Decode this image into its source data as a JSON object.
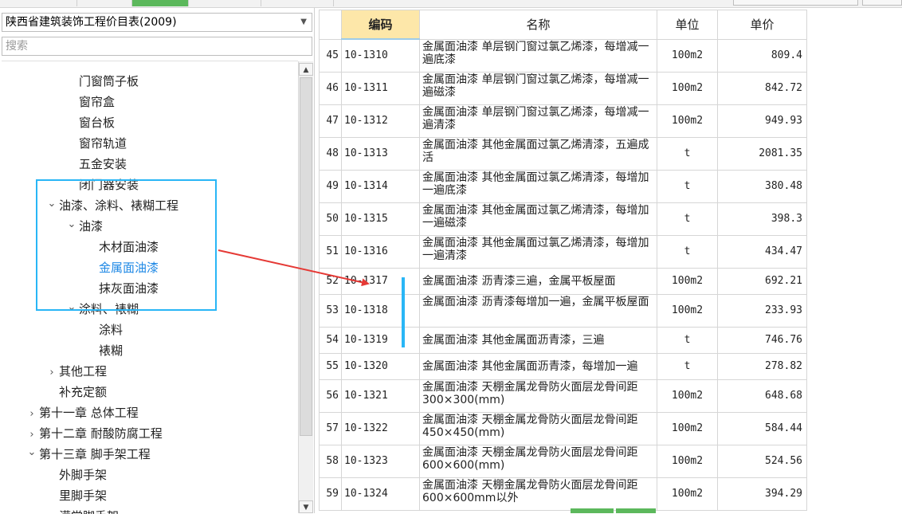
{
  "library": {
    "selected": "陕西省建筑装饰工程价目表(2009)"
  },
  "search": {
    "placeholder": "搜索"
  },
  "tree": [
    {
      "label": "门窗筒子板",
      "indent": 3,
      "expanded": null,
      "selected": false
    },
    {
      "label": "窗帘盒",
      "indent": 3,
      "expanded": null,
      "selected": false
    },
    {
      "label": "窗台板",
      "indent": 3,
      "expanded": null,
      "selected": false
    },
    {
      "label": "窗帘轨道",
      "indent": 3,
      "expanded": null,
      "selected": false
    },
    {
      "label": "五金安装",
      "indent": 3,
      "expanded": null,
      "selected": false
    },
    {
      "label": "闭门器安装",
      "indent": 3,
      "expanded": null,
      "selected": false
    },
    {
      "label": "油漆、涂料、裱糊工程",
      "indent": 2,
      "expanded": true,
      "selected": false
    },
    {
      "label": "油漆",
      "indent": 3,
      "expanded": true,
      "selected": false
    },
    {
      "label": "木材面油漆",
      "indent": 4,
      "expanded": null,
      "selected": false
    },
    {
      "label": "金属面油漆",
      "indent": 4,
      "expanded": null,
      "selected": true
    },
    {
      "label": "抹灰面油漆",
      "indent": 4,
      "expanded": null,
      "selected": false
    },
    {
      "label": "涂料、裱糊",
      "indent": 3,
      "expanded": true,
      "selected": false
    },
    {
      "label": "涂料",
      "indent": 4,
      "expanded": null,
      "selected": false
    },
    {
      "label": "裱糊",
      "indent": 4,
      "expanded": null,
      "selected": false
    },
    {
      "label": "其他工程",
      "indent": 2,
      "expanded": false,
      "selected": false
    },
    {
      "label": "补充定额",
      "indent": 2,
      "expanded": null,
      "selected": false
    },
    {
      "label": "第十一章 总体工程",
      "indent": 1,
      "expanded": false,
      "selected": false
    },
    {
      "label": "第十二章 耐酸防腐工程",
      "indent": 1,
      "expanded": false,
      "selected": false
    },
    {
      "label": "第十三章 脚手架工程",
      "indent": 1,
      "expanded": true,
      "selected": false
    },
    {
      "label": "外脚手架",
      "indent": 2,
      "expanded": null,
      "selected": false
    },
    {
      "label": "里脚手架",
      "indent": 2,
      "expanded": null,
      "selected": false
    },
    {
      "label": "满堂脚手架",
      "indent": 2,
      "expanded": null,
      "selected": false
    }
  ],
  "table": {
    "headers": {
      "code": "编码",
      "name": "名称",
      "unit": "单位",
      "price": "单价"
    },
    "rows": [
      {
        "no": "45",
        "code": "10-1310",
        "name": "金属面油漆 单层钢门窗过氯乙烯漆，每增减一遍底漆",
        "unit": "100m2",
        "price": "809.4"
      },
      {
        "no": "46",
        "code": "10-1311",
        "name": "金属面油漆 单层钢门窗过氯乙烯漆，每增减一遍磁漆",
        "unit": "100m2",
        "price": "842.72"
      },
      {
        "no": "47",
        "code": "10-1312",
        "name": "金属面油漆 单层钢门窗过氯乙烯漆，每增减一遍清漆",
        "unit": "100m2",
        "price": "949.93"
      },
      {
        "no": "48",
        "code": "10-1313",
        "name": "金属面油漆 其他金属面过氯乙烯清漆，五遍成活",
        "unit": "t",
        "price": "2081.35"
      },
      {
        "no": "49",
        "code": "10-1314",
        "name": "金属面油漆 其他金属面过氯乙烯清漆，每增加一遍底漆",
        "unit": "t",
        "price": "380.48"
      },
      {
        "no": "50",
        "code": "10-1315",
        "name": "金属面油漆 其他金属面过氯乙烯清漆，每增加一遍磁漆",
        "unit": "t",
        "price": "398.3"
      },
      {
        "no": "51",
        "code": "10-1316",
        "name": "金属面油漆 其他金属面过氯乙烯清漆，每增加一遍清漆",
        "unit": "t",
        "price": "434.47"
      },
      {
        "no": "52",
        "code": "10-1317",
        "name": "金属面油漆 沥青漆三遍，金属平板屋面",
        "unit": "100m2",
        "price": "692.21"
      },
      {
        "no": "53",
        "code": "10-1318",
        "name": "金属面油漆 沥青漆每增加一遍，金属平板屋面",
        "unit": "100m2",
        "price": "233.93"
      },
      {
        "no": "54",
        "code": "10-1319",
        "name": "金属面油漆 其他金属面沥青漆，三遍",
        "unit": "t",
        "price": "746.76"
      },
      {
        "no": "55",
        "code": "10-1320",
        "name": "金属面油漆 其他金属面沥青漆，每增加一遍",
        "unit": "t",
        "price": "278.82"
      },
      {
        "no": "56",
        "code": "10-1321",
        "name": "金属面油漆 天棚金属龙骨防火面层龙骨间距300×300(mm)",
        "unit": "100m2",
        "price": "648.68"
      },
      {
        "no": "57",
        "code": "10-1322",
        "name": "金属面油漆 天棚金属龙骨防火面层龙骨间距450×450(mm)",
        "unit": "100m2",
        "price": "584.44"
      },
      {
        "no": "58",
        "code": "10-1323",
        "name": "金属面油漆 天棚金属龙骨防火面层龙骨间距600×600(mm)",
        "unit": "100m2",
        "price": "524.56"
      },
      {
        "no": "59",
        "code": "10-1324",
        "name": "金属面油漆 天棚金属龙骨防火面层龙骨间距600×600mm以外",
        "unit": "100m2",
        "price": "394.29"
      }
    ]
  },
  "colors": {
    "accent": "#1e88e5",
    "highlight": "#29b6f6",
    "arrow": "#e53935",
    "header_sorted": "#fde7a9",
    "tab_green": "#5cb85c"
  },
  "icons": {
    "dropdown": "chevron-down-icon",
    "expanded": "chevron-down-icon",
    "collapsed": "chevron-right-icon"
  }
}
